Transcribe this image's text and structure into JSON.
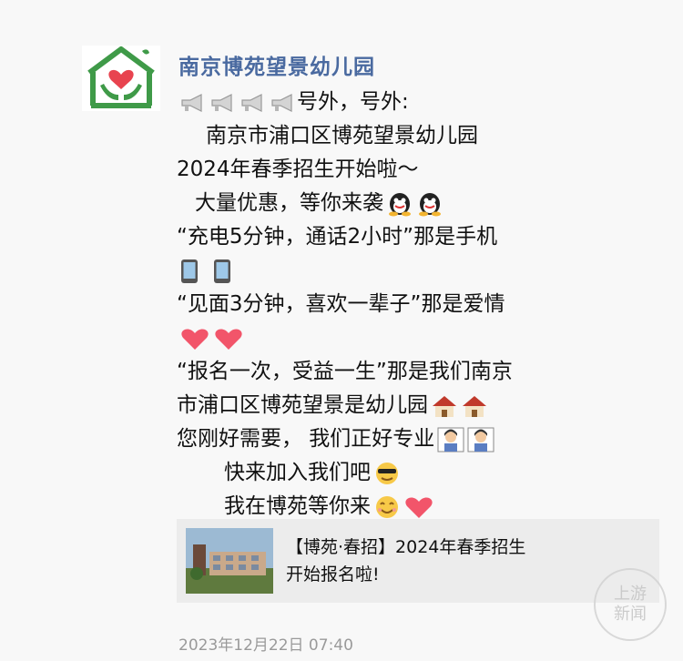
{
  "post": {
    "author": "南京博苑望景幼儿园",
    "lines": {
      "l0": "号外，号外:",
      "l1": "南京市浦口区博苑望景幼儿园",
      "l2": "2024年春季招生开始啦～",
      "l3": "大量优惠，等你来袭",
      "l4": "“充电5分钟，通话2小时”那是手机",
      "l5": "“见面3分钟，喜欢一辈子”那是爱情",
      "l6": "“报名一次，受益一生”那是我们南京",
      "l7": "市浦口区博苑望景是幼儿园",
      "l8": "您刚好需要，  我们正好专业",
      "l9": "快来加入我们吧",
      "l10": "我在博苑等你来"
    },
    "link_title_1": "【博苑·春招】2024年春季招生",
    "link_title_2": "开始报名啦!",
    "timestamp": "2023年12月22日 07:40"
  },
  "watermark": {
    "line1": "上游",
    "line2": "新闻"
  },
  "colors": {
    "author": "#4a6aa0",
    "logo_green": "#3f9a48",
    "heart_red": "#e8434f"
  },
  "icons": [
    "megaphone-icon",
    "ghost-emoji-icon",
    "phone-icon",
    "heart-icon",
    "house-icon",
    "teacher-icon",
    "cool-face-icon",
    "smile-face-icon"
  ]
}
